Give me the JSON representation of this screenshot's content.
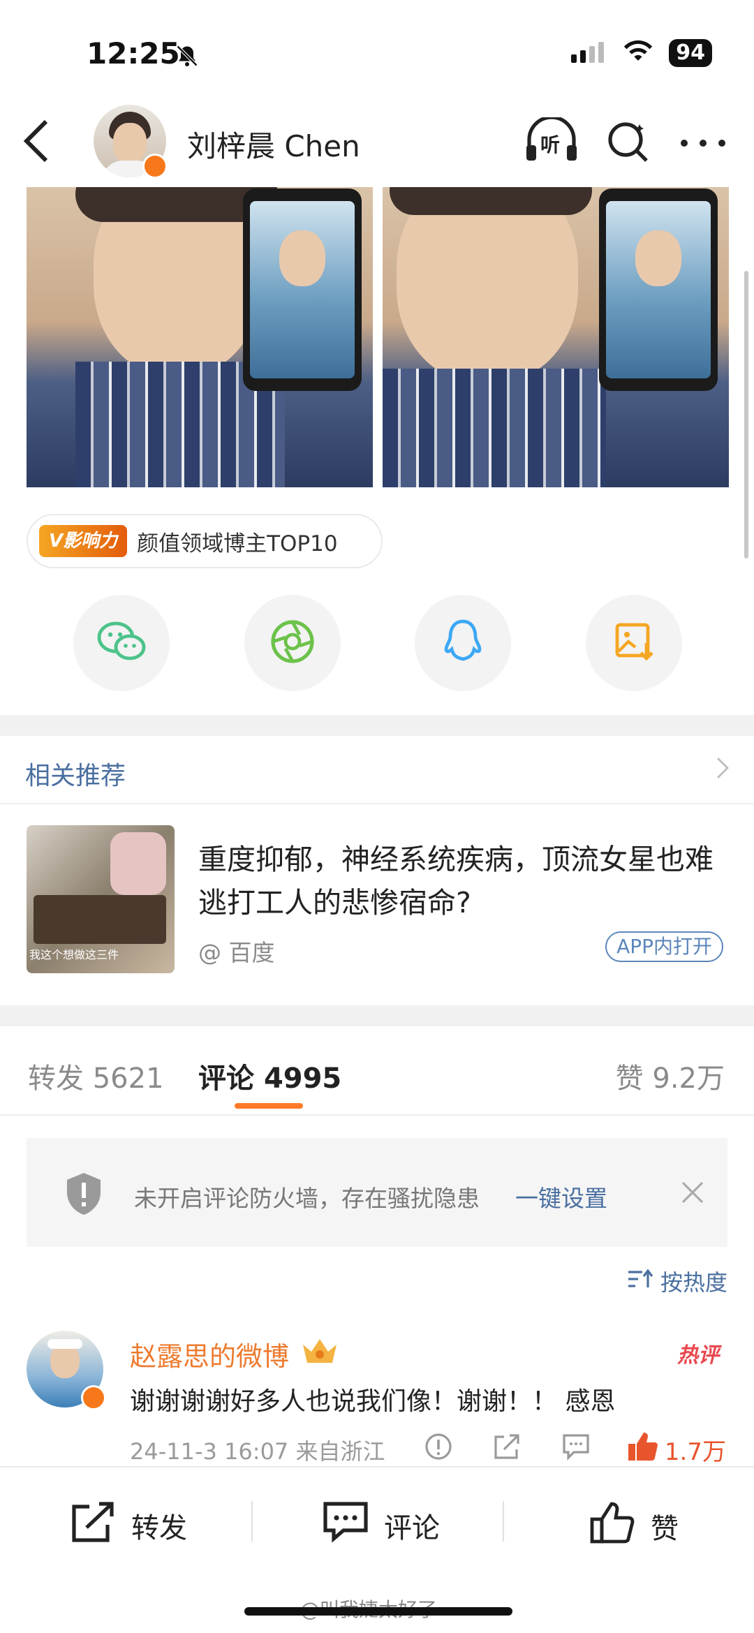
{
  "status_bar": {
    "time": "12:25",
    "battery": "94"
  },
  "nav": {
    "title": "刘梓晨 Chen",
    "listen_label": "听"
  },
  "influence": {
    "tag": "V影响力",
    "text": "颜值领域博主TOP10"
  },
  "related": {
    "title": "相关推荐",
    "item": {
      "title": "重度抑郁，神经系统疾病，顶流女星也难逃打工人的悲惨宿命?",
      "source": "@ 百度",
      "open_label": "APP内打开",
      "thumb_caption": "我这个想做这三件"
    }
  },
  "tabs": {
    "repost_label": "转发",
    "repost_count": "5621",
    "comment_label": "评论",
    "comment_count": "4995",
    "like_label": "赞",
    "like_count": "9.2万"
  },
  "notice": {
    "text": "未开启评论防火墙，存在骚扰隐患",
    "link": "一键设置"
  },
  "sort": {
    "label": "按热度"
  },
  "comment": {
    "name": "赵露思的微博",
    "hot_tag": "热评",
    "text": "谢谢谢谢好多人也说我们像！谢谢！！ 感恩",
    "meta": "24-11-3 16:07 来自浙江",
    "likes": "1.7万"
  },
  "bottom_bar": {
    "repost": "转发",
    "comment": "评论",
    "like": "赞"
  },
  "watermark": "@叫我婕太好了",
  "colors": {
    "accent_orange": "#ff7a28",
    "link_blue": "#4a6fa0",
    "hot_red": "#e8484e"
  }
}
